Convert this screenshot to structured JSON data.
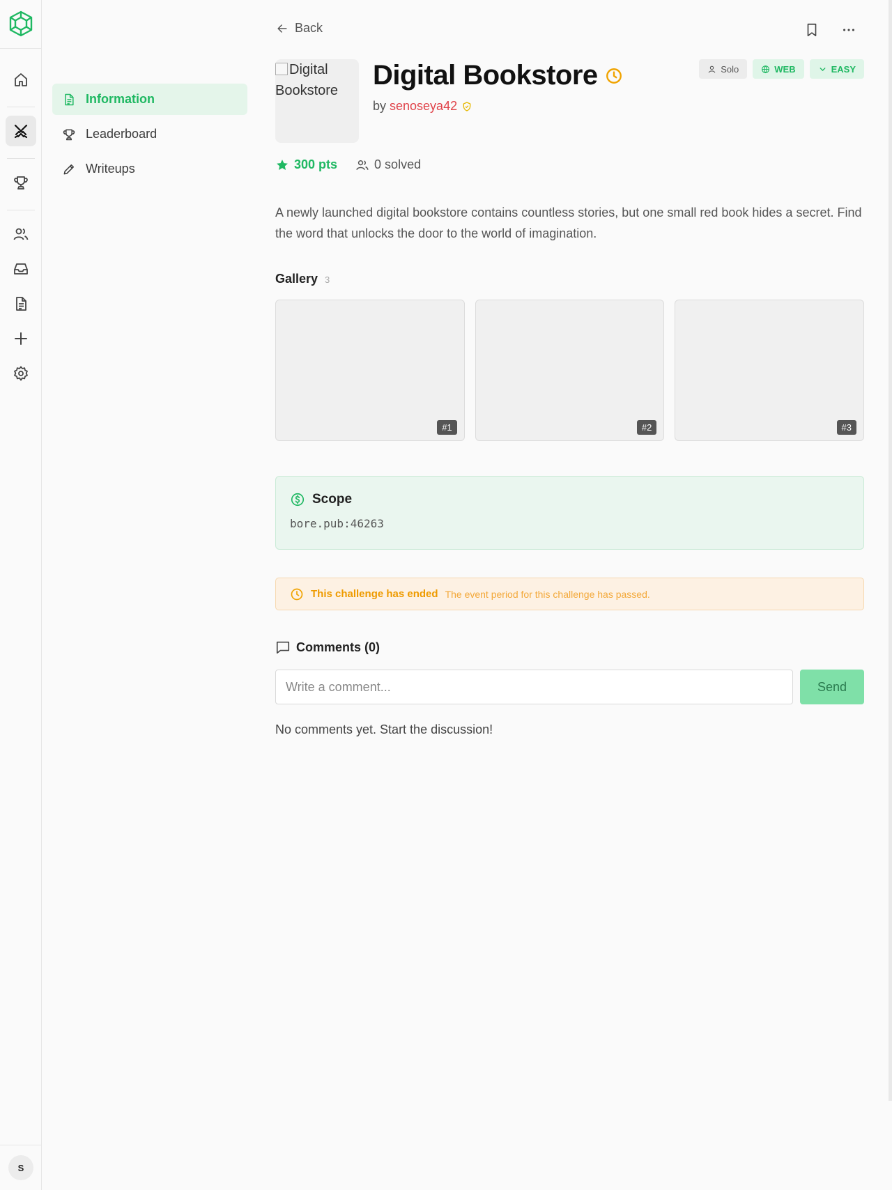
{
  "nav": {
    "back_label": "Back"
  },
  "sidebar": {
    "items": [
      {
        "label": "Information",
        "icon": "document-icon"
      },
      {
        "label": "Leaderboard",
        "icon": "trophy-icon"
      },
      {
        "label": "Writeups",
        "icon": "pencil-icon"
      }
    ]
  },
  "rail": {
    "avatar_initial": "S"
  },
  "challenge": {
    "thumbnail_alt": "Digital Bookstore",
    "title": "Digital Bookstore",
    "author_prefix": "by",
    "author": "senoseya42",
    "points": "300 pts",
    "solved": "0 solved",
    "description": "A newly launched digital bookstore contains countless stories, but one small red book hides a secret. Find the word that unlocks the door to the world of imagination.",
    "tags": [
      {
        "label": "Solo"
      },
      {
        "label": "WEB"
      },
      {
        "label": "EASY"
      }
    ]
  },
  "gallery": {
    "heading": "Gallery",
    "count": "3",
    "images": [
      "#1",
      "#2",
      "#3"
    ]
  },
  "scope": {
    "heading": "Scope",
    "address": "bore.pub:46263"
  },
  "notice": {
    "title": "This challenge has ended",
    "subtitle": "The event period for this challenge has passed."
  },
  "comments": {
    "heading": "Comments (0)",
    "placeholder": "Write a comment...",
    "send_label": "Send",
    "empty_text": "No comments yet. Start the discussion!"
  },
  "colors": {
    "accent": "#1fb862",
    "author": "#e0434a",
    "warning": "#ee9b00"
  }
}
